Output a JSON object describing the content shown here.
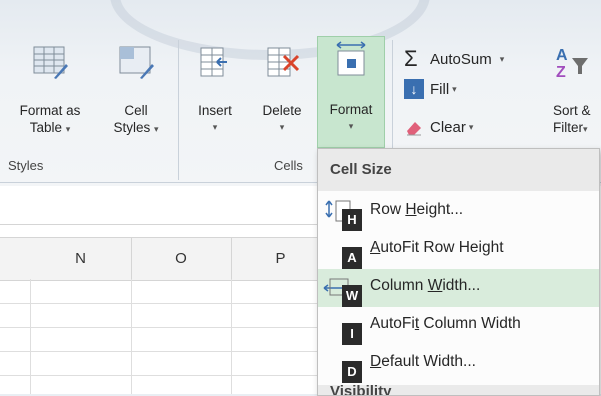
{
  "ribbon": {
    "format_as_table": {
      "line1": "Format as",
      "line2": "Table",
      "caret": "▾"
    },
    "cell_styles": {
      "line1": "Cell",
      "line2": "Styles",
      "caret": "▾"
    },
    "insert": {
      "label": "Insert",
      "caret": "▾"
    },
    "delete": {
      "label": "Delete",
      "caret": "▾"
    },
    "format": {
      "label": "Format",
      "caret": "▾"
    },
    "autosum": {
      "label": "AutoSum",
      "caret": "▾"
    },
    "fill": {
      "label": "Fill",
      "caret": "▾"
    },
    "clear": {
      "label": "Clear",
      "caret": "▾"
    },
    "sort_filter": {
      "line1": "Sort &",
      "line2": "Filter",
      "caret": "▾"
    },
    "groups": {
      "styles": "Styles",
      "cells": "Cells"
    }
  },
  "sheet": {
    "columns": [
      "N",
      "O",
      "P"
    ]
  },
  "menu": {
    "header": "Cell Size",
    "items": [
      {
        "pre": "Row ",
        "u": "H",
        "post": "eight...",
        "key": "H"
      },
      {
        "pre": "",
        "u": "A",
        "post": "utoFit Row Height",
        "key": "A"
      },
      {
        "pre": "Column ",
        "u": "W",
        "post": "idth...",
        "key": "W"
      },
      {
        "pre": "AutoFi",
        "u": "t",
        "post": " Column Width",
        "key": "I"
      },
      {
        "pre": "",
        "u": "D",
        "post": "efault Width...",
        "key": "D"
      }
    ],
    "next_header_partial": "Visibility"
  },
  "colors": {
    "highlight": "#d9ecdc",
    "format_button": "#c8e6cf",
    "key_tip": "#2b2b2b"
  }
}
